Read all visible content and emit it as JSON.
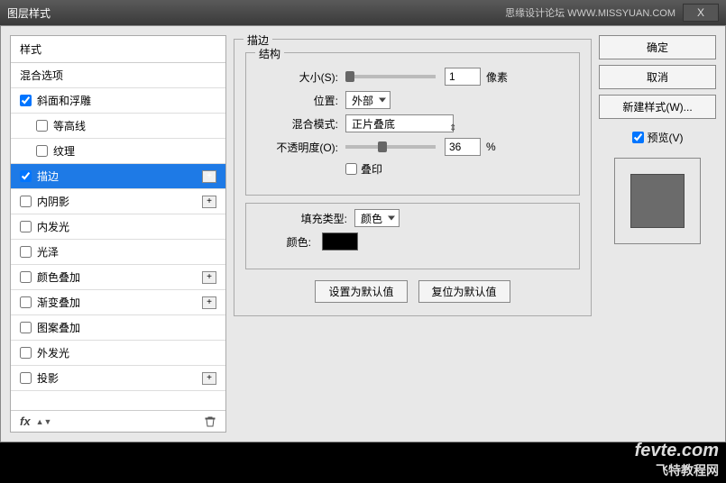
{
  "window": {
    "title": "图层样式",
    "right_text": "思缘设计论坛  WWW.MISSYUAN.COM",
    "close": "X"
  },
  "styles_panel": {
    "header": "样式",
    "blend_options": "混合选项",
    "items": [
      {
        "label": "斜面和浮雕",
        "checked": true,
        "expandable": false,
        "indent": false
      },
      {
        "label": "等高线",
        "checked": false,
        "expandable": false,
        "indent": true
      },
      {
        "label": "纹理",
        "checked": false,
        "expandable": false,
        "indent": true
      },
      {
        "label": "描边",
        "checked": true,
        "expandable": true,
        "indent": false,
        "selected": true
      },
      {
        "label": "内阴影",
        "checked": false,
        "expandable": true,
        "indent": false
      },
      {
        "label": "内发光",
        "checked": false,
        "expandable": false,
        "indent": false
      },
      {
        "label": "光泽",
        "checked": false,
        "expandable": false,
        "indent": false
      },
      {
        "label": "颜色叠加",
        "checked": false,
        "expandable": true,
        "indent": false
      },
      {
        "label": "渐变叠加",
        "checked": false,
        "expandable": true,
        "indent": false
      },
      {
        "label": "图案叠加",
        "checked": false,
        "expandable": false,
        "indent": false
      },
      {
        "label": "外发光",
        "checked": false,
        "expandable": false,
        "indent": false
      },
      {
        "label": "投影",
        "checked": false,
        "expandable": true,
        "indent": false
      }
    ],
    "footer_fx": "fx"
  },
  "main": {
    "panel_title": "描边",
    "structure_title": "结构",
    "size_label": "大小(S):",
    "size_value": "1",
    "size_unit": "像素",
    "position_label": "位置:",
    "position_value": "外部",
    "blend_label": "混合模式:",
    "blend_value": "正片叠底",
    "opacity_label": "不透明度(O):",
    "opacity_value": "36",
    "opacity_unit": "%",
    "overprint_label": "叠印",
    "filltype_label": "填充类型:",
    "filltype_value": "颜色",
    "color_label": "颜色:",
    "color_value": "#000000",
    "set_default": "设置为默认值",
    "reset_default": "复位为默认值"
  },
  "right": {
    "ok": "确定",
    "cancel": "取消",
    "new_style": "新建样式(W)...",
    "preview_label": "预览(V)"
  },
  "watermark": {
    "main": "fevte.com",
    "sub": "飞特教程网"
  }
}
